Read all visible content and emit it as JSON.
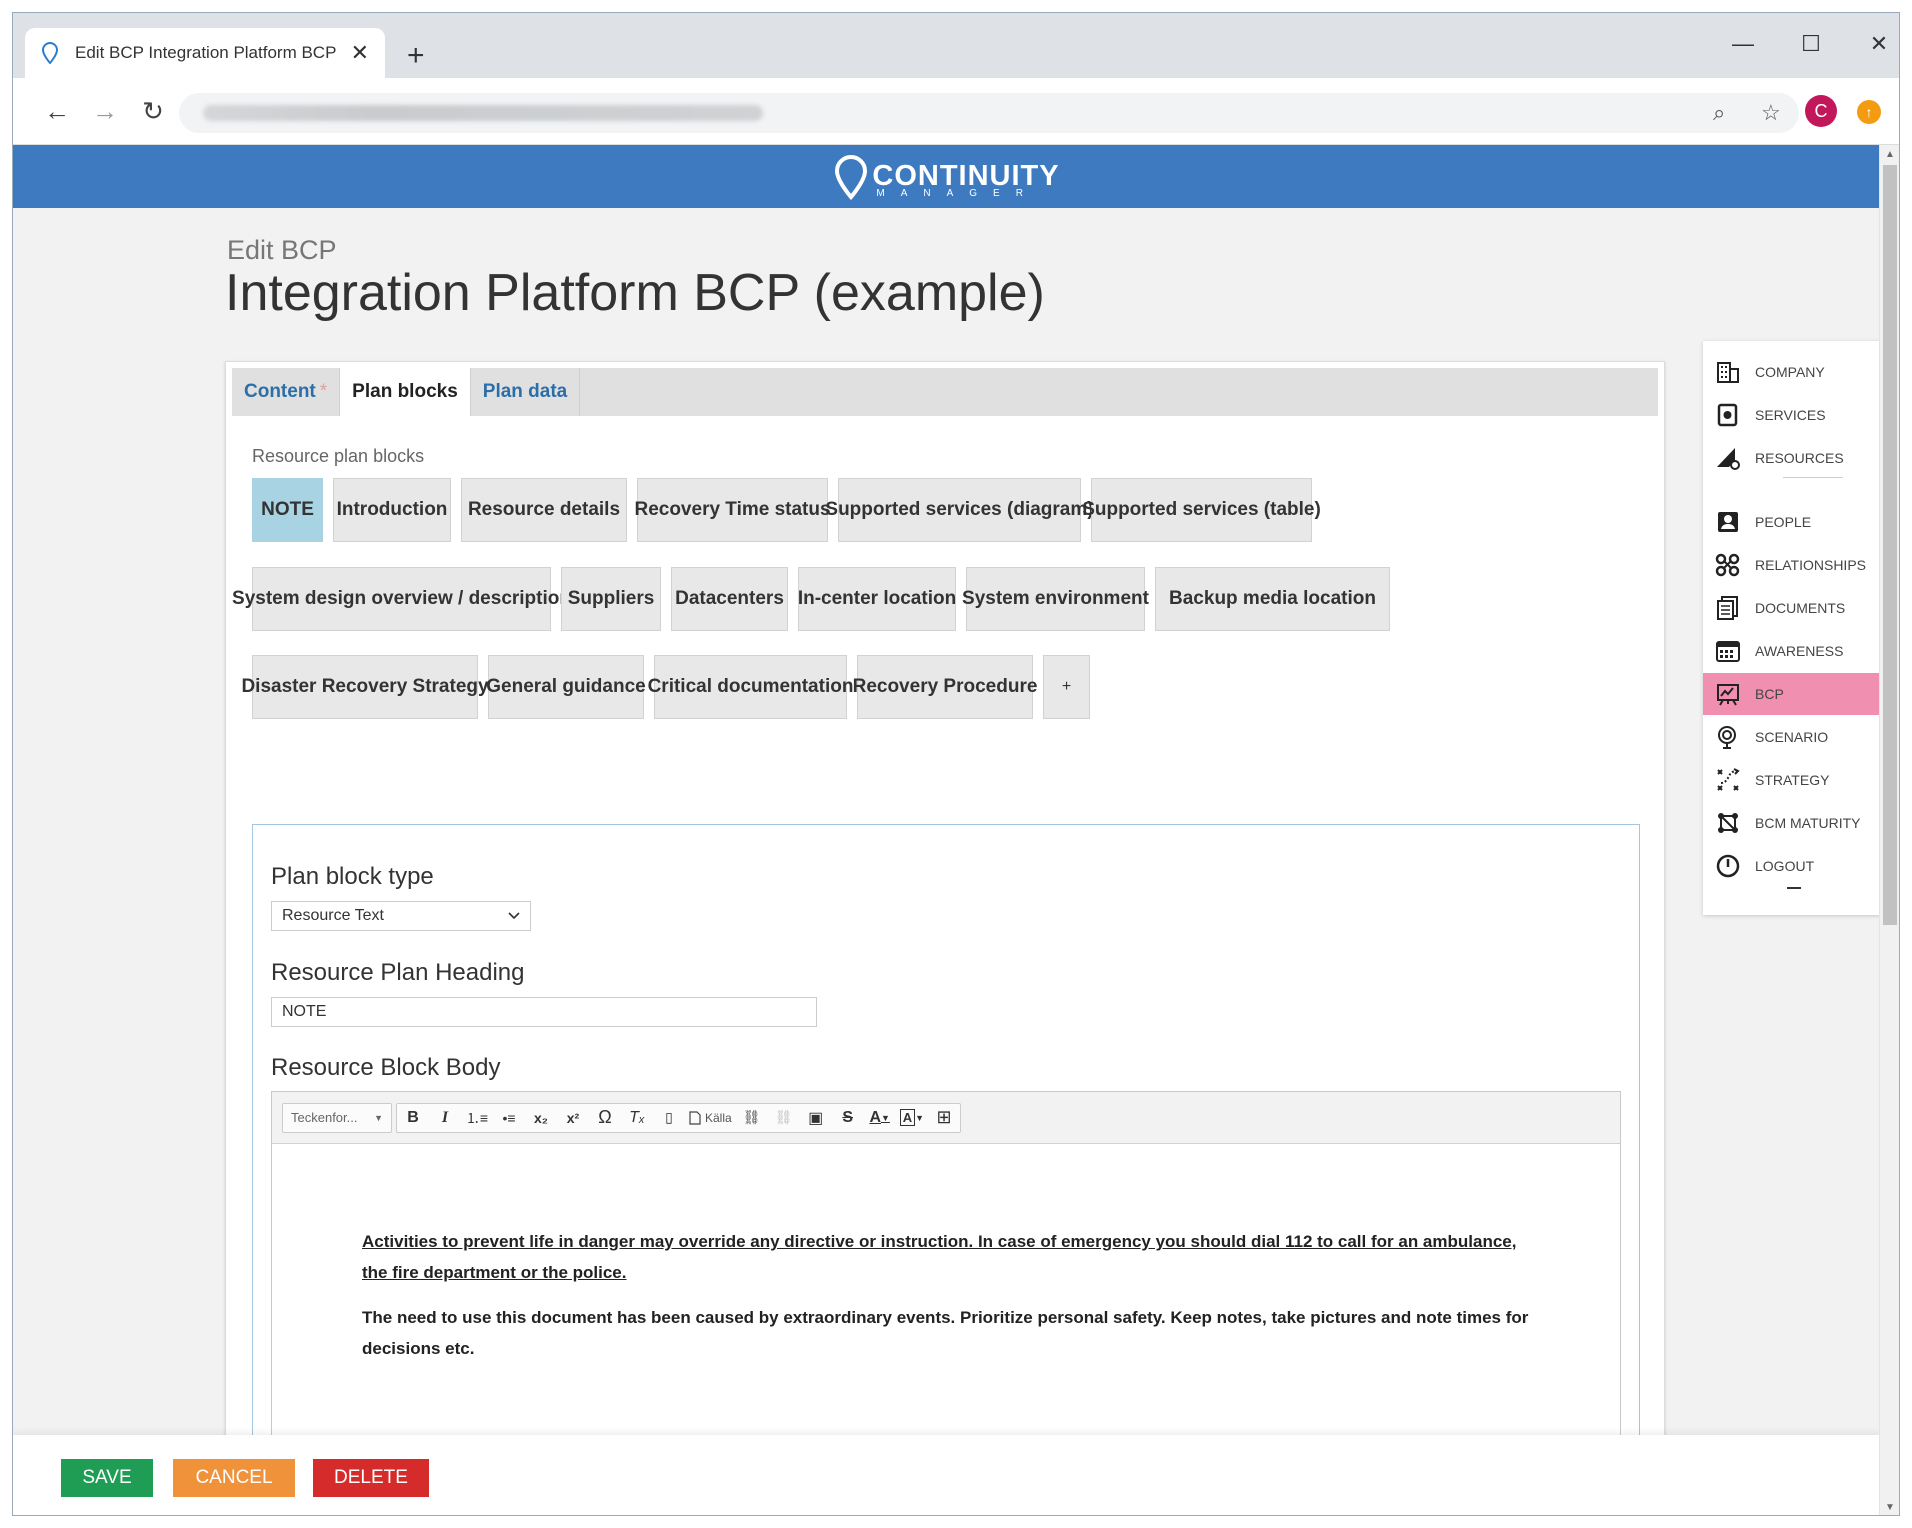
{
  "browser": {
    "tab_title": "Edit BCP Integration Platform BCP",
    "new_tab": "+",
    "minimize": "—",
    "maximize": "☐",
    "close": "✕",
    "back": "←",
    "forward": "→",
    "reload": "↻",
    "zoom": "⌕",
    "bookmark": "☆",
    "avatar_letter": "C",
    "extension": "↑"
  },
  "header": {
    "logo_word": "CONTINUITY",
    "logo_sub": "MANAGER"
  },
  "page": {
    "subtitle": "Edit BCP",
    "title": "Integration Platform BCP (example)"
  },
  "tabs": [
    {
      "label": "Content",
      "star": "*"
    },
    {
      "label": "Plan blocks"
    },
    {
      "label": "Plan data"
    }
  ],
  "section_label": "Resource plan blocks",
  "plan_blocks": [
    "NOTE",
    "Introduction",
    "Resource details",
    "Recovery Time status",
    "Supported services (diagram)",
    "Supported services (table)",
    "System design overview / description",
    "Suppliers",
    "Datacenters",
    "In-center location",
    "System environment",
    "Backup media location",
    "Disaster Recovery Strategy",
    "General guidance",
    "Critical documentation",
    "Recovery Procedure",
    "+"
  ],
  "form": {
    "type_label": "Plan block type",
    "type_value": "Resource Text",
    "heading_label": "Resource Plan Heading",
    "heading_value": "NOTE",
    "body_label": "Resource Block Body",
    "font_combo": "Teckenfor...",
    "source_label": "Källa",
    "body_p1": "Activities to prevent life in danger may override any directive or instruction. In case of emergency you should dial 112 to call for an ambulance, the fire department or the police.",
    "body_p2": "The need to use this document has been caused by extraordinary events. Prioritize personal safety.  Keep notes, take pictures and note times for decisions etc."
  },
  "sidenav": [
    {
      "label": "COMPANY",
      "icon": "building-icon"
    },
    {
      "label": "SERVICES",
      "icon": "services-icon"
    },
    {
      "label": "RESOURCES",
      "icon": "resources-icon"
    },
    {
      "label": "PEOPLE",
      "icon": "person-icon"
    },
    {
      "label": "RELATIONSHIPS",
      "icon": "relationships-icon"
    },
    {
      "label": "DOCUMENTS",
      "icon": "documents-icon"
    },
    {
      "label": "AWARENESS",
      "icon": "calendar-icon"
    },
    {
      "label": "BCP",
      "icon": "bcp-icon"
    },
    {
      "label": "SCENARIO",
      "icon": "scenario-icon"
    },
    {
      "label": "STRATEGY",
      "icon": "strategy-icon"
    },
    {
      "label": "BCM MATURITY",
      "icon": "maturity-icon"
    },
    {
      "label": "LOGOUT",
      "icon": "power-icon"
    }
  ],
  "footer": {
    "save": "SAVE",
    "cancel": "CANCEL",
    "delete": "DELETE"
  },
  "colors": {
    "banner": "#3d7abf",
    "active_nav": "#f08fb0",
    "active_block": "#a8d3e3",
    "save": "#1f9d55",
    "cancel": "#f0923a",
    "delete": "#d52b2b"
  }
}
